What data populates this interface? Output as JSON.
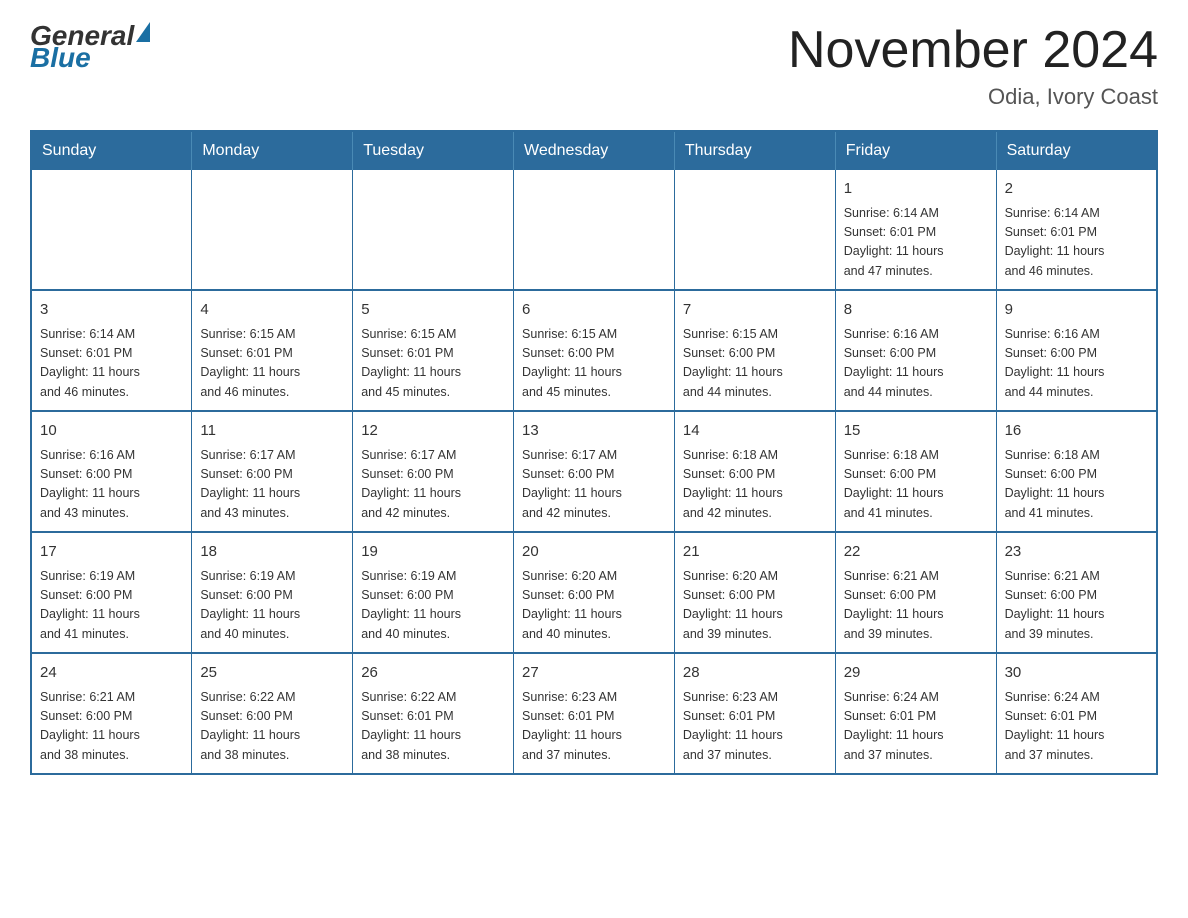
{
  "header": {
    "logo_general": "General",
    "logo_blue": "Blue",
    "month_title": "November 2024",
    "location": "Odia, Ivory Coast"
  },
  "weekdays": [
    "Sunday",
    "Monday",
    "Tuesday",
    "Wednesday",
    "Thursday",
    "Friday",
    "Saturday"
  ],
  "weeks": [
    [
      {
        "day": "",
        "info": ""
      },
      {
        "day": "",
        "info": ""
      },
      {
        "day": "",
        "info": ""
      },
      {
        "day": "",
        "info": ""
      },
      {
        "day": "",
        "info": ""
      },
      {
        "day": "1",
        "info": "Sunrise: 6:14 AM\nSunset: 6:01 PM\nDaylight: 11 hours\nand 47 minutes."
      },
      {
        "day": "2",
        "info": "Sunrise: 6:14 AM\nSunset: 6:01 PM\nDaylight: 11 hours\nand 46 minutes."
      }
    ],
    [
      {
        "day": "3",
        "info": "Sunrise: 6:14 AM\nSunset: 6:01 PM\nDaylight: 11 hours\nand 46 minutes."
      },
      {
        "day": "4",
        "info": "Sunrise: 6:15 AM\nSunset: 6:01 PM\nDaylight: 11 hours\nand 46 minutes."
      },
      {
        "day": "5",
        "info": "Sunrise: 6:15 AM\nSunset: 6:01 PM\nDaylight: 11 hours\nand 45 minutes."
      },
      {
        "day": "6",
        "info": "Sunrise: 6:15 AM\nSunset: 6:00 PM\nDaylight: 11 hours\nand 45 minutes."
      },
      {
        "day": "7",
        "info": "Sunrise: 6:15 AM\nSunset: 6:00 PM\nDaylight: 11 hours\nand 44 minutes."
      },
      {
        "day": "8",
        "info": "Sunrise: 6:16 AM\nSunset: 6:00 PM\nDaylight: 11 hours\nand 44 minutes."
      },
      {
        "day": "9",
        "info": "Sunrise: 6:16 AM\nSunset: 6:00 PM\nDaylight: 11 hours\nand 44 minutes."
      }
    ],
    [
      {
        "day": "10",
        "info": "Sunrise: 6:16 AM\nSunset: 6:00 PM\nDaylight: 11 hours\nand 43 minutes."
      },
      {
        "day": "11",
        "info": "Sunrise: 6:17 AM\nSunset: 6:00 PM\nDaylight: 11 hours\nand 43 minutes."
      },
      {
        "day": "12",
        "info": "Sunrise: 6:17 AM\nSunset: 6:00 PM\nDaylight: 11 hours\nand 42 minutes."
      },
      {
        "day": "13",
        "info": "Sunrise: 6:17 AM\nSunset: 6:00 PM\nDaylight: 11 hours\nand 42 minutes."
      },
      {
        "day": "14",
        "info": "Sunrise: 6:18 AM\nSunset: 6:00 PM\nDaylight: 11 hours\nand 42 minutes."
      },
      {
        "day": "15",
        "info": "Sunrise: 6:18 AM\nSunset: 6:00 PM\nDaylight: 11 hours\nand 41 minutes."
      },
      {
        "day": "16",
        "info": "Sunrise: 6:18 AM\nSunset: 6:00 PM\nDaylight: 11 hours\nand 41 minutes."
      }
    ],
    [
      {
        "day": "17",
        "info": "Sunrise: 6:19 AM\nSunset: 6:00 PM\nDaylight: 11 hours\nand 41 minutes."
      },
      {
        "day": "18",
        "info": "Sunrise: 6:19 AM\nSunset: 6:00 PM\nDaylight: 11 hours\nand 40 minutes."
      },
      {
        "day": "19",
        "info": "Sunrise: 6:19 AM\nSunset: 6:00 PM\nDaylight: 11 hours\nand 40 minutes."
      },
      {
        "day": "20",
        "info": "Sunrise: 6:20 AM\nSunset: 6:00 PM\nDaylight: 11 hours\nand 40 minutes."
      },
      {
        "day": "21",
        "info": "Sunrise: 6:20 AM\nSunset: 6:00 PM\nDaylight: 11 hours\nand 39 minutes."
      },
      {
        "day": "22",
        "info": "Sunrise: 6:21 AM\nSunset: 6:00 PM\nDaylight: 11 hours\nand 39 minutes."
      },
      {
        "day": "23",
        "info": "Sunrise: 6:21 AM\nSunset: 6:00 PM\nDaylight: 11 hours\nand 39 minutes."
      }
    ],
    [
      {
        "day": "24",
        "info": "Sunrise: 6:21 AM\nSunset: 6:00 PM\nDaylight: 11 hours\nand 38 minutes."
      },
      {
        "day": "25",
        "info": "Sunrise: 6:22 AM\nSunset: 6:00 PM\nDaylight: 11 hours\nand 38 minutes."
      },
      {
        "day": "26",
        "info": "Sunrise: 6:22 AM\nSunset: 6:01 PM\nDaylight: 11 hours\nand 38 minutes."
      },
      {
        "day": "27",
        "info": "Sunrise: 6:23 AM\nSunset: 6:01 PM\nDaylight: 11 hours\nand 37 minutes."
      },
      {
        "day": "28",
        "info": "Sunrise: 6:23 AM\nSunset: 6:01 PM\nDaylight: 11 hours\nand 37 minutes."
      },
      {
        "day": "29",
        "info": "Sunrise: 6:24 AM\nSunset: 6:01 PM\nDaylight: 11 hours\nand 37 minutes."
      },
      {
        "day": "30",
        "info": "Sunrise: 6:24 AM\nSunset: 6:01 PM\nDaylight: 11 hours\nand 37 minutes."
      }
    ]
  ]
}
